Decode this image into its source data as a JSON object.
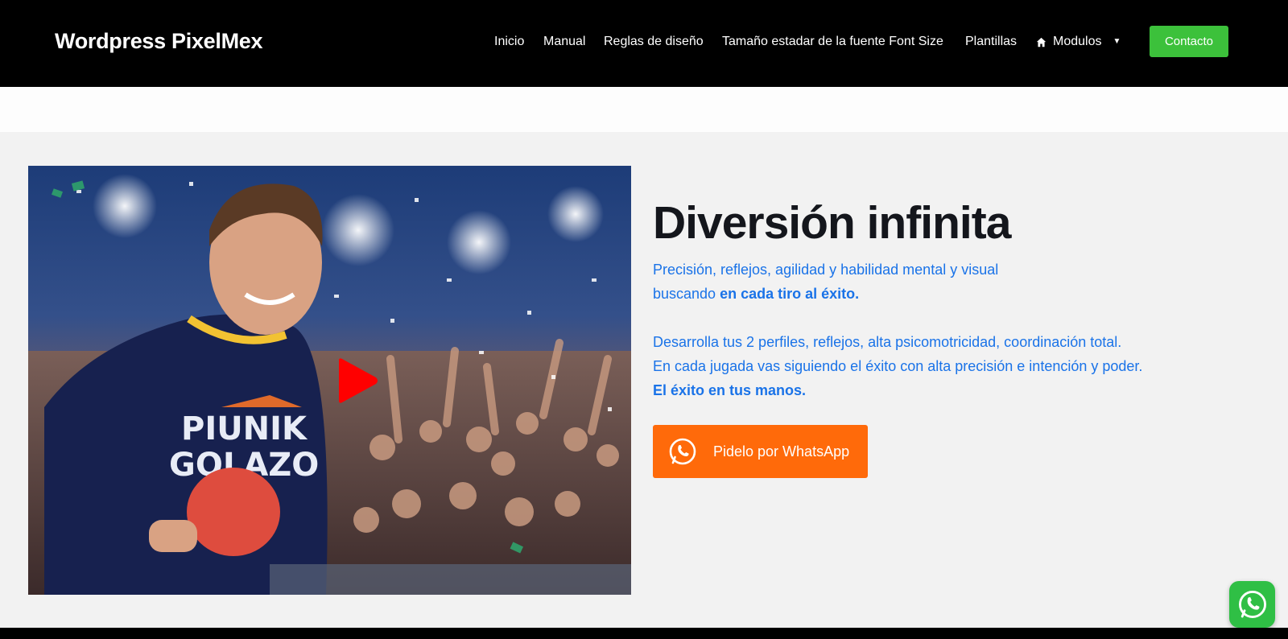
{
  "header": {
    "brand": "Wordpress PixelMex",
    "nav": [
      {
        "label": "Inicio"
      },
      {
        "label": "Manual"
      },
      {
        "label": "Reglas de diseño"
      },
      {
        "label": "Tamaño estadar de la fuente Font Size"
      },
      {
        "label": "Plantillas"
      },
      {
        "label": "Modulos",
        "icon": "home-icon",
        "dropdown": true
      }
    ],
    "contact_label": "Contacto"
  },
  "hero": {
    "image_icon": "video-thumbnail",
    "play_icon": "play-icon",
    "shirt_text_line1": "PIUNIK",
    "shirt_text_line2": "GOLAZO"
  },
  "content": {
    "headline": "Diversión infinita",
    "p1_line1": "Precisión, reflejos, agilidad y habilidad mental y visual",
    "p1_line2_prefix": "buscando ",
    "p1_line2_bold": "en cada tiro al éxito.",
    "p2_line1": "Desarrolla tus 2 perfiles, reflejos, alta psicomotricidad, coordinación total.",
    "p2_line2": "En cada jugada vas siguiendo el éxito con alta precisión e intención y poder.",
    "p2_line3_bold": "El éxito en tus manos.",
    "cta_label": "Pidelo por WhatsApp",
    "cta_icon": "whatsapp-icon"
  },
  "floating": {
    "icon": "whatsapp-icon"
  },
  "colors": {
    "header_bg": "#000000",
    "contact_green": "#3cc13b",
    "text_blue": "#1a73e8",
    "cta_orange": "#ff6a0a",
    "float_green": "#2fbf45",
    "play_red": "#ff0000"
  }
}
